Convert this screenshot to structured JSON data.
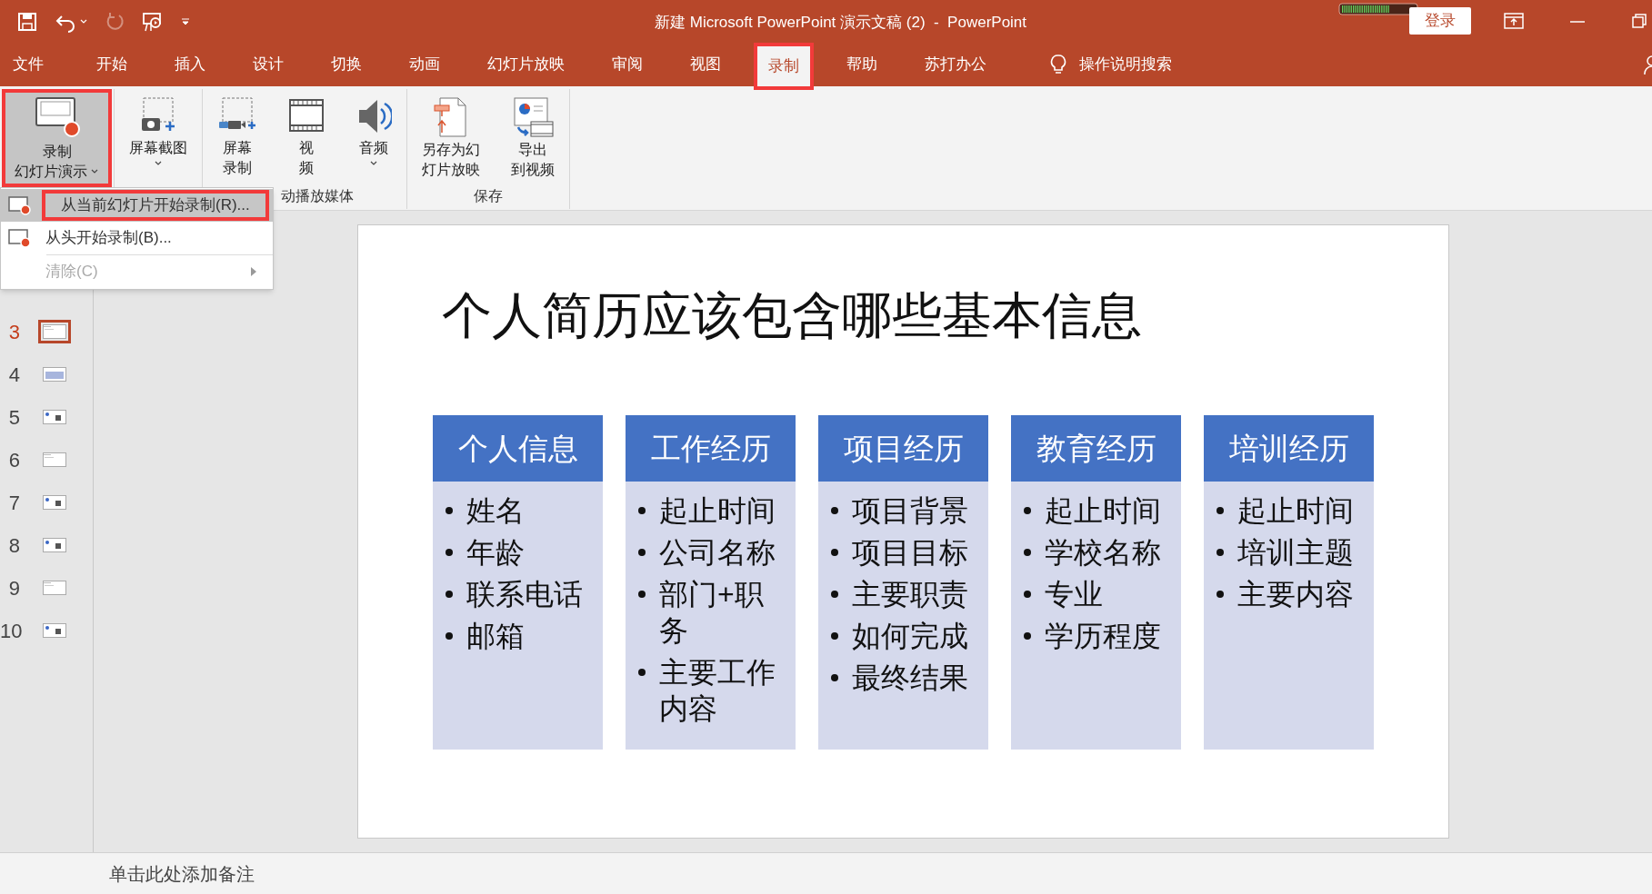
{
  "window": {
    "title": "新建 Microsoft PowerPoint 演示文稿 (2)  -  PowerPoint",
    "sign_in": "登录"
  },
  "quick_access": [
    {
      "kind": "save",
      "disabled": false
    },
    {
      "kind": "undo",
      "disabled": false
    },
    {
      "kind": "redo",
      "disabled": true
    },
    {
      "kind": "present",
      "disabled": false
    },
    {
      "kind": "customize",
      "disabled": false
    }
  ],
  "tabs": [
    {
      "label": "文件",
      "selected": false,
      "highlighted": false
    },
    {
      "label": "开始",
      "selected": false,
      "highlighted": false
    },
    {
      "label": "插入",
      "selected": false,
      "highlighted": false
    },
    {
      "label": "设计",
      "selected": false,
      "highlighted": false
    },
    {
      "label": "切换",
      "selected": false,
      "highlighted": false
    },
    {
      "label": "动画",
      "selected": false,
      "highlighted": false
    },
    {
      "label": "幻灯片放映",
      "selected": false,
      "highlighted": false
    },
    {
      "label": "审阅",
      "selected": false,
      "highlighted": false
    },
    {
      "label": "视图",
      "selected": false,
      "highlighted": false
    },
    {
      "label": "录制",
      "selected": true,
      "highlighted": true
    },
    {
      "label": "帮助",
      "selected": false,
      "highlighted": false
    },
    {
      "label": "苏打办公",
      "selected": false,
      "highlighted": false
    }
  ],
  "tell_me": "操作说明搜索",
  "ribbon": {
    "groups": [
      {
        "buttons": [
          {
            "kind": "record",
            "lines": [
              "录制",
              "幻灯片演示"
            ],
            "dropdown": true,
            "highlighted": true,
            "pressed": true
          }
        ]
      },
      {
        "buttons": [
          {
            "kind": "screenshot",
            "lines": [
              "屏幕截图"
            ],
            "dropdown": true,
            "highlighted": false,
            "pressed": false
          }
        ]
      },
      {
        "label": "动播放媒体",
        "buttons": [
          {
            "kind": "screen-record",
            "lines": [
              "屏幕",
              "录制"
            ],
            "dropdown": false,
            "highlighted": false,
            "pressed": false
          },
          {
            "kind": "video",
            "lines": [
              "视",
              "频"
            ],
            "dropdown": false,
            "highlighted": false,
            "pressed": false
          },
          {
            "kind": "audio",
            "lines": [
              "音频"
            ],
            "dropdown": true,
            "highlighted": false,
            "pressed": false
          }
        ]
      },
      {
        "label": "保存",
        "buttons": [
          {
            "kind": "save-show",
            "lines": [
              "另存为幻",
              "灯片放映"
            ],
            "dropdown": false,
            "highlighted": false,
            "pressed": false
          },
          {
            "kind": "export-video",
            "lines": [
              "导出",
              "到视频"
            ],
            "dropdown": false,
            "highlighted": false,
            "pressed": false
          }
        ]
      }
    ]
  },
  "menu": {
    "items": [
      {
        "kind": "record",
        "label": "从当前幻灯片开始录制(R)...",
        "selected": true,
        "highlighted": true,
        "disabled": false
      },
      {
        "kind": "record",
        "label": "从头开始录制(B)...",
        "selected": false,
        "highlighted": false,
        "disabled": false
      },
      {
        "kind": "submenu",
        "label": "清除(C)",
        "selected": false,
        "highlighted": false,
        "disabled": true
      }
    ]
  },
  "slides": [
    {
      "number": "3",
      "selected": true
    },
    {
      "number": "4",
      "selected": false
    },
    {
      "number": "5",
      "selected": false
    },
    {
      "number": "6",
      "selected": false
    },
    {
      "number": "7",
      "selected": false
    },
    {
      "number": "8",
      "selected": false
    },
    {
      "number": "9",
      "selected": false
    },
    {
      "number": "10",
      "selected": false
    }
  ],
  "slide": {
    "title": "个人简历应该包含哪些基本信息",
    "columns": [
      {
        "heading": "个人信息",
        "bullets": [
          "姓名",
          "年龄",
          "联系电话",
          "邮箱"
        ]
      },
      {
        "heading": "工作经历",
        "bullets": [
          "起止时间",
          "公司名称",
          "部门+职务",
          "主要工作内容"
        ]
      },
      {
        "heading": "项目经历",
        "bullets": [
          "项目背景",
          "项目目标",
          "主要职责",
          "如何完成",
          "最终结果"
        ]
      },
      {
        "heading": "教育经历",
        "bullets": [
          "起止时间",
          "学校名称",
          "专业",
          "学历程度"
        ]
      },
      {
        "heading": "培训经历",
        "bullets": [
          "起止时间",
          "培训主题",
          "主要内容"
        ]
      }
    ]
  },
  "notes": {
    "placeholder": "单击此处添加备注"
  }
}
